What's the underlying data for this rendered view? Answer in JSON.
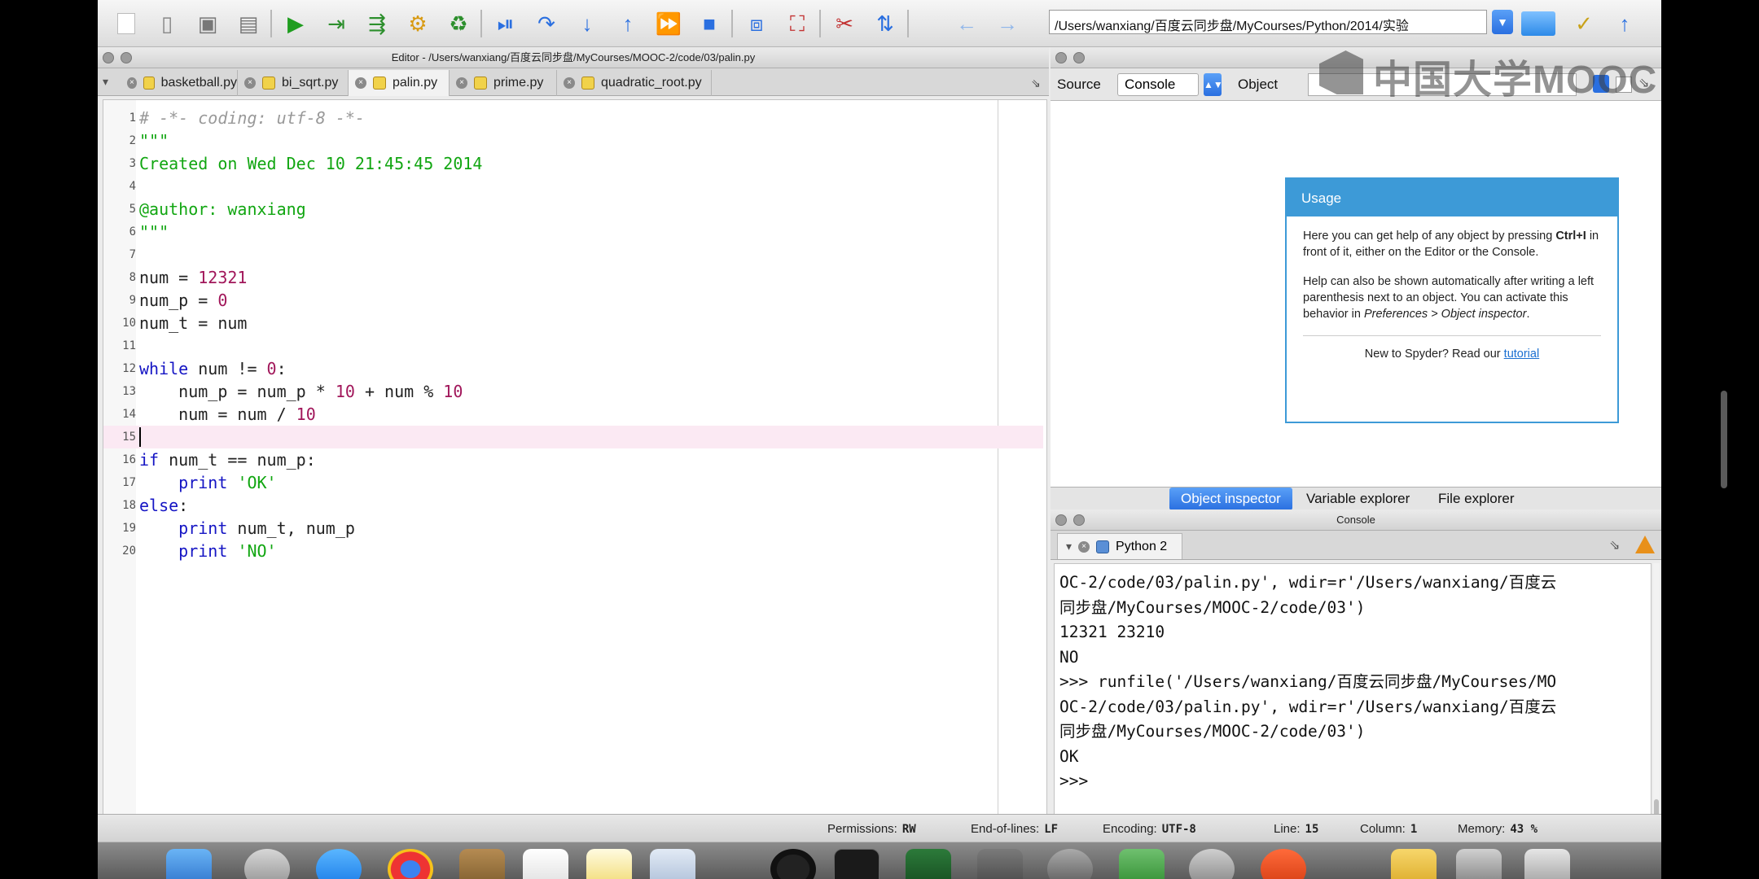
{
  "toolbar": {
    "working_dir": "/Users/wanxiang/百度云同步盘/MyCourses/Python/2014/实验",
    "colors": {
      "run_green": "#1f9d1f",
      "accent_blue": "#2a6fe0"
    }
  },
  "editor": {
    "title": "Editor - /Users/wanxiang/百度云同步盘/MyCourses/MOOC-2/code/03/palin.py",
    "tabs": [
      {
        "label": "basketball.py"
      },
      {
        "label": "bi_sqrt.py"
      },
      {
        "label": "palin.py",
        "active": true
      },
      {
        "label": "prime.py"
      },
      {
        "label": "quadratic_root.py"
      }
    ],
    "current_line": 15,
    "lines": [
      {
        "n": "1",
        "tokens": [
          [
            "c-comment",
            "# -*- coding: utf-8 -*-"
          ]
        ]
      },
      {
        "n": "2",
        "tokens": [
          [
            "c-string",
            "\"\"\""
          ]
        ]
      },
      {
        "n": "3",
        "tokens": [
          [
            "c-string",
            "Created on Wed Dec 10 21:45:45 2014"
          ]
        ]
      },
      {
        "n": "4",
        "tokens": []
      },
      {
        "n": "5",
        "tokens": [
          [
            "c-string",
            "@author: wanxiang"
          ]
        ]
      },
      {
        "n": "6",
        "tokens": [
          [
            "c-string",
            "\"\"\""
          ]
        ]
      },
      {
        "n": "7",
        "tokens": []
      },
      {
        "n": "8",
        "tokens": [
          [
            "c-plain",
            "num = "
          ],
          [
            "c-number",
            "12321"
          ]
        ]
      },
      {
        "n": "9",
        "tokens": [
          [
            "c-plain",
            "num_p = "
          ],
          [
            "c-number",
            "0"
          ]
        ]
      },
      {
        "n": "10",
        "tokens": [
          [
            "c-plain",
            "num_t = num"
          ]
        ]
      },
      {
        "n": "11",
        "tokens": []
      },
      {
        "n": "12",
        "tokens": [
          [
            "c-keyword",
            "while"
          ],
          [
            "c-plain",
            " num != "
          ],
          [
            "c-number",
            "0"
          ],
          [
            "c-plain",
            ":"
          ]
        ]
      },
      {
        "n": "13",
        "tokens": [
          [
            "c-plain",
            "    num_p = num_p * "
          ],
          [
            "c-number",
            "10"
          ],
          [
            "c-plain",
            " + num % "
          ],
          [
            "c-number",
            "10"
          ]
        ]
      },
      {
        "n": "14",
        "tokens": [
          [
            "c-plain",
            "    num = num / "
          ],
          [
            "c-number",
            "10"
          ]
        ]
      },
      {
        "n": "15",
        "tokens": []
      },
      {
        "n": "16",
        "tokens": [
          [
            "c-keyword",
            "if"
          ],
          [
            "c-plain",
            " num_t == num_p:"
          ]
        ]
      },
      {
        "n": "17",
        "tokens": [
          [
            "c-plain",
            "    "
          ],
          [
            "c-keyword",
            "print"
          ],
          [
            "c-plain",
            " "
          ],
          [
            "c-string",
            "'OK'"
          ]
        ]
      },
      {
        "n": "18",
        "tokens": [
          [
            "c-keyword",
            "else"
          ],
          [
            "c-plain",
            ":"
          ]
        ]
      },
      {
        "n": "19",
        "tokens": [
          [
            "c-plain",
            "    "
          ],
          [
            "c-keyword",
            "print"
          ],
          [
            "c-plain",
            " num_t, num_p"
          ]
        ]
      },
      {
        "n": "20",
        "tokens": [
          [
            "c-plain",
            "    "
          ],
          [
            "c-keyword",
            "print"
          ],
          [
            "c-plain",
            " "
          ],
          [
            "c-string",
            "'NO'"
          ]
        ]
      }
    ]
  },
  "inspector": {
    "source_label": "Source",
    "source_value": "Console",
    "object_label": "Object",
    "usage": {
      "title": "Usage",
      "para1_a": "Here you can get help of any object by pressing ",
      "para1_key": "Ctrl+I",
      "para1_b": " in front of it, either on the Editor or the Console.",
      "para2_a": "Help can also be shown automatically after writing a left parenthesis next to an object. You can activate this behavior in ",
      "para2_em": "Preferences > Object inspector",
      "para2_b": ".",
      "footer_text": "New to Spyder? Read our ",
      "footer_link": "tutorial"
    },
    "tabs": [
      {
        "label": "Object inspector",
        "active": true
      },
      {
        "label": "Variable explorer"
      },
      {
        "label": "File explorer"
      }
    ]
  },
  "console": {
    "title": "Console",
    "tab_label": "Python 2",
    "lines": [
      "OC-2/code/03/palin.py', wdir=r'/Users/wanxiang/百度云",
      "同步盘/MyCourses/MOOC-2/code/03')",
      "12321 23210",
      "NO",
      ">>> runfile('/Users/wanxiang/百度云同步盘/MyCourses/MO",
      "OC-2/code/03/palin.py', wdir=r'/Users/wanxiang/百度云",
      "同步盘/MyCourses/MOOC-2/code/03')",
      "OK",
      ">>> "
    ]
  },
  "statusbar": {
    "permissions_label": "Permissions:",
    "permissions_value": "RW",
    "eol_label": "End-of-lines:",
    "eol_value": "LF",
    "encoding_label": "Encoding:",
    "encoding_value": "UTF-8",
    "line_label": "Line:",
    "line_value": "15",
    "column_label": "Column:",
    "column_value": "1",
    "memory_label": "Memory:",
    "memory_value": "43 %"
  },
  "watermark": {
    "text": "中国大学MOOC"
  }
}
